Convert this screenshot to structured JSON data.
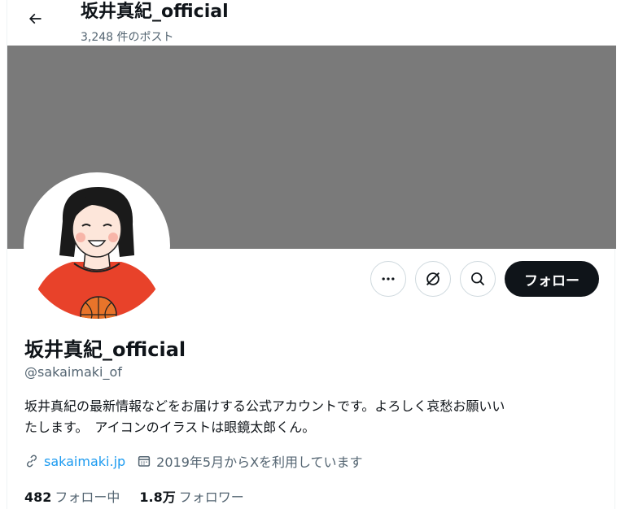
{
  "header": {
    "title": "坂井真紀_official",
    "post_count": "3,248 件のポスト"
  },
  "profile": {
    "display_name": "坂井真紀_official",
    "handle": "@sakaimaki_of",
    "bio_line1": "坂井真紀の最新情報などをお届けする公式アカウントです。よろしく哀愁お願いい",
    "bio_line2": "たします。　アイコンのイラストは眼鏡太郎くん。",
    "website": "sakaimaki.jp",
    "joined": "2019年5月からXを利用しています"
  },
  "actions": {
    "follow_label": "フォロー"
  },
  "stats": {
    "following_count": "482",
    "following_label": "フォロー中",
    "followers_count": "1.8万",
    "followers_label": "フォロワー"
  },
  "colors": {
    "banner": "#7a7a7a",
    "link": "#1d9bf0",
    "follow_button_bg": "#0f1419",
    "secondary_text": "#536471"
  },
  "icons": [
    "back-arrow-icon",
    "more-icon",
    "grok-icon",
    "search-icon",
    "link-icon",
    "calendar-icon"
  ]
}
